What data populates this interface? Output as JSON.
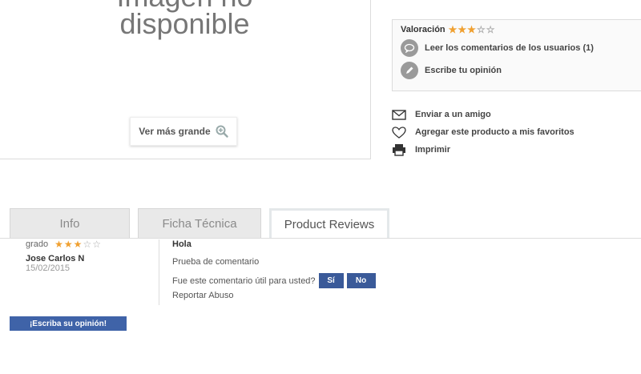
{
  "image_panel": {
    "no_image_line1": "Imagen no",
    "no_image_line2": "disponible",
    "zoom_label": "Ver más grande"
  },
  "rating_box": {
    "label": "Valoración",
    "rating": 3,
    "max_rating": 5,
    "read_comments": "Leer los comentarios de los usuarios (1)",
    "write_opinion": "Escribe tu opinión"
  },
  "actions": {
    "send_friend": "Enviar a un amigo",
    "add_favorites": "Agregar este producto a mis favoritos",
    "print": "Imprimir"
  },
  "tabs": [
    {
      "label": "Info"
    },
    {
      "label": "Ficha Técnica"
    },
    {
      "label": "Product Reviews"
    }
  ],
  "review": {
    "grade_label": "grado",
    "rating": 3,
    "author": "Jose Carlos N",
    "date": "15/02/2015",
    "title": "Hola",
    "text": "Prueba de comentario",
    "useful_question": "Fue este comentario útil para usted?",
    "yes_label": "Sí",
    "no_label": "No",
    "report_label": "Reportar Abuso"
  },
  "write_review_button": "¡Escriba su opinión!",
  "colors": {
    "star": "#f0a030",
    "button_blue": "#3a5a99"
  }
}
